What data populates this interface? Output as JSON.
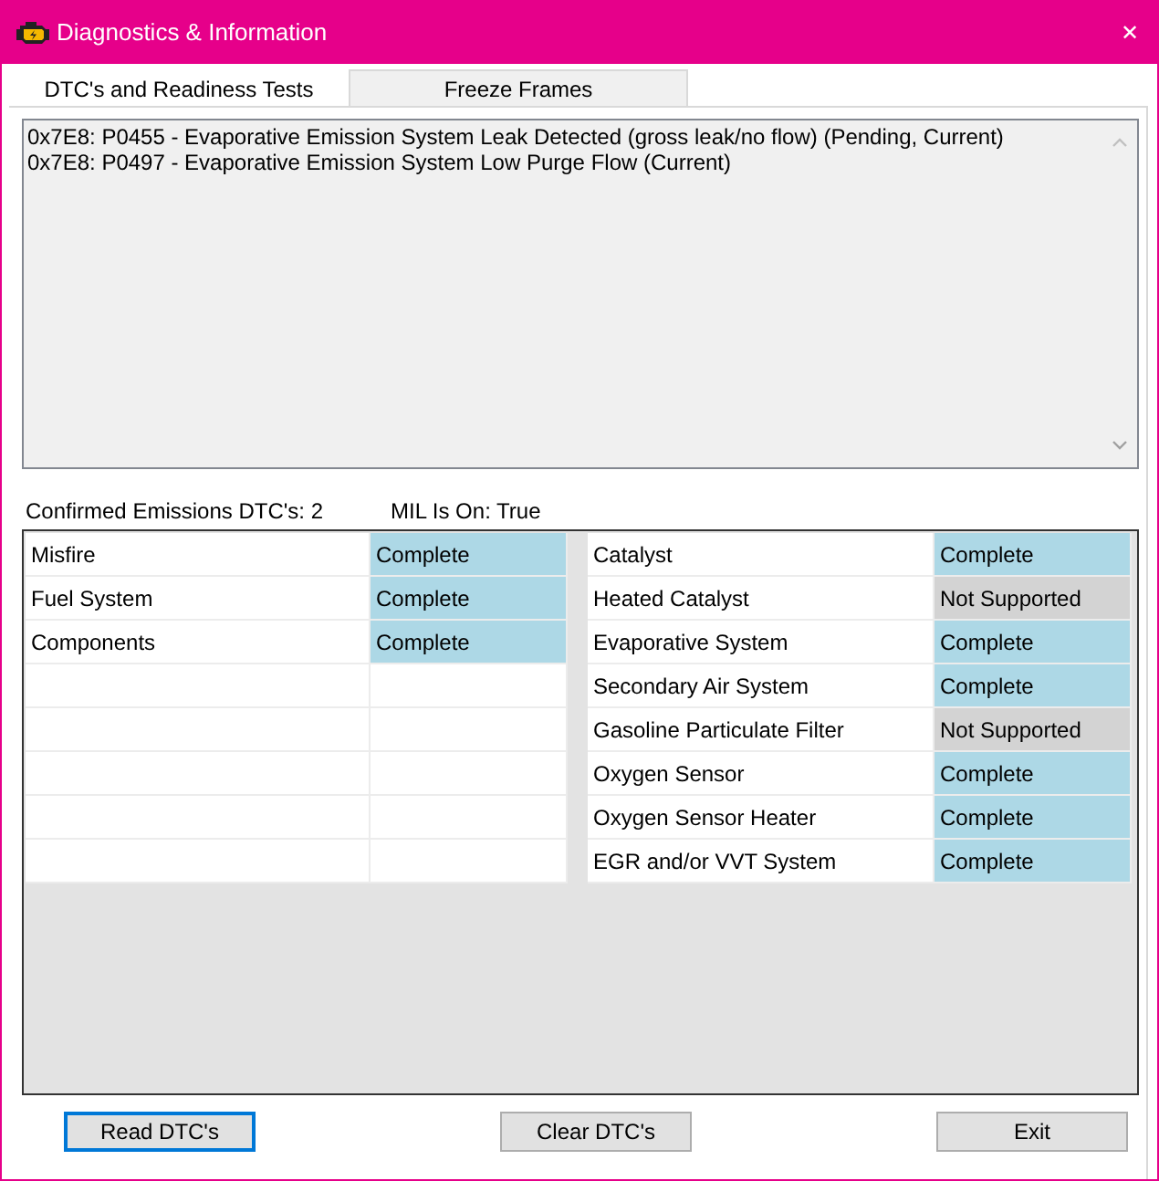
{
  "window": {
    "title": "Diagnostics & Information"
  },
  "tabs": [
    {
      "label": "DTC's and Readiness Tests",
      "selected": true
    },
    {
      "label": "Freeze Frames",
      "selected": false
    }
  ],
  "dtc_list": [
    "0x7E8: P0455 - Evaporative Emission System Leak Detected (gross leak/no flow) (Pending, Current)",
    "0x7E8: P0497 - Evaporative Emission System Low Purge Flow (Current)"
  ],
  "summary": {
    "confirmed": "Confirmed Emissions DTC's: 2",
    "mil": "MIL Is On: True"
  },
  "readiness_left": [
    {
      "name": "Misfire",
      "status": "Complete",
      "kind": "complete"
    },
    {
      "name": "Fuel System",
      "status": "Complete",
      "kind": "complete"
    },
    {
      "name": "Components",
      "status": "Complete",
      "kind": "complete"
    }
  ],
  "readiness_right": [
    {
      "name": "Catalyst",
      "status": "Complete",
      "kind": "complete"
    },
    {
      "name": "Heated Catalyst",
      "status": "Not Supported",
      "kind": "not_supported"
    },
    {
      "name": "Evaporative System",
      "status": "Complete",
      "kind": "complete"
    },
    {
      "name": "Secondary Air System",
      "status": "Complete",
      "kind": "complete"
    },
    {
      "name": "Gasoline Particulate Filter",
      "status": "Not Supported",
      "kind": "not_supported"
    },
    {
      "name": "Oxygen Sensor",
      "status": "Complete",
      "kind": "complete"
    },
    {
      "name": "Oxygen Sensor Heater",
      "status": "Complete",
      "kind": "complete"
    },
    {
      "name": "EGR and/or VVT System",
      "status": "Complete",
      "kind": "complete"
    }
  ],
  "buttons": [
    {
      "label": "Read DTC's",
      "focused": true
    },
    {
      "label": "Clear DTC's",
      "focused": false
    },
    {
      "label": "Exit",
      "focused": false
    }
  ],
  "close_glyph": "✕"
}
